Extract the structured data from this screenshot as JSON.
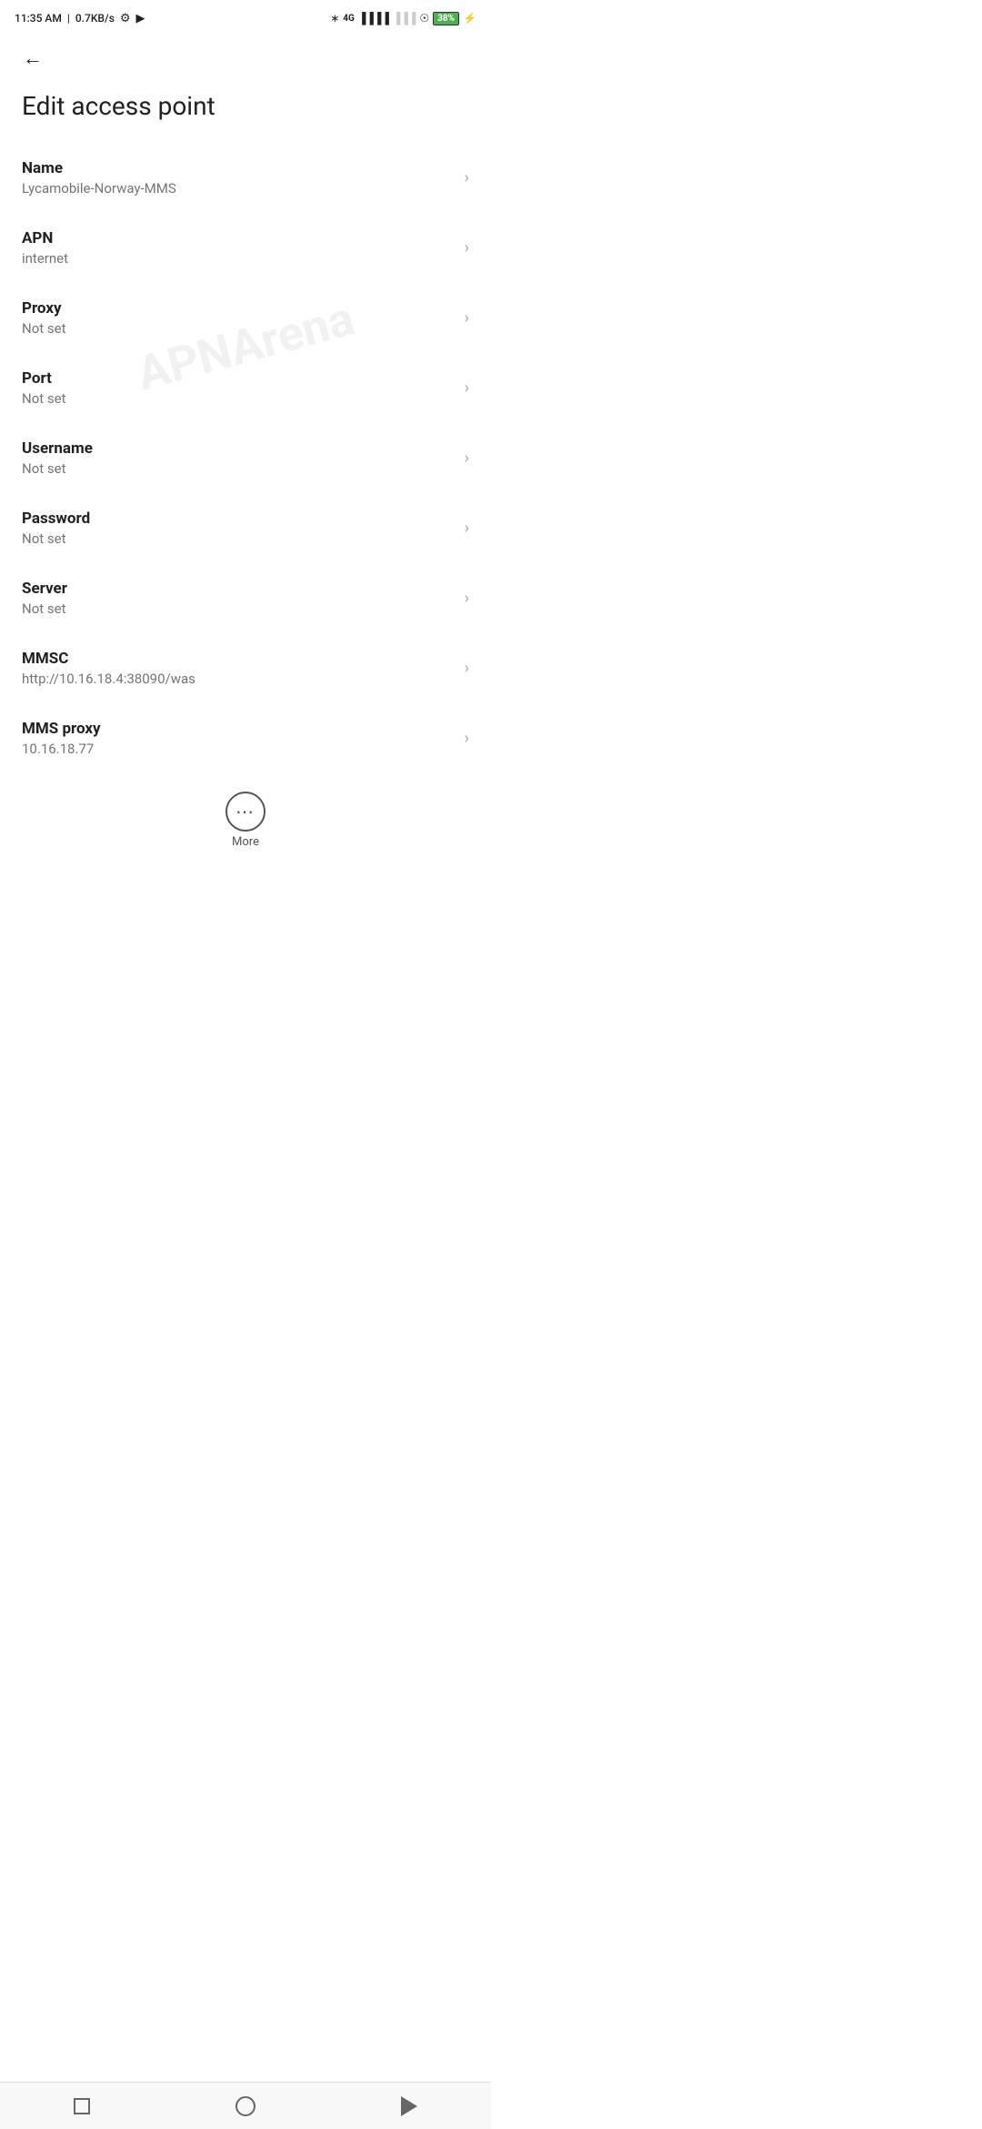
{
  "statusBar": {
    "time": "11:35 AM",
    "speed": "0.7KB/s",
    "battery": "38"
  },
  "nav": {
    "backLabel": "←"
  },
  "page": {
    "title": "Edit access point"
  },
  "fields": [
    {
      "label": "Name",
      "value": "Lycamobile-Norway-MMS"
    },
    {
      "label": "APN",
      "value": "internet"
    },
    {
      "label": "Proxy",
      "value": "Not set"
    },
    {
      "label": "Port",
      "value": "Not set"
    },
    {
      "label": "Username",
      "value": "Not set"
    },
    {
      "label": "Password",
      "value": "Not set"
    },
    {
      "label": "Server",
      "value": "Not set"
    },
    {
      "label": "MMSC",
      "value": "http://10.16.18.4:38090/was"
    },
    {
      "label": "MMS proxy",
      "value": "10.16.18.77"
    }
  ],
  "more": {
    "label": "More"
  },
  "watermark": "APNArena"
}
